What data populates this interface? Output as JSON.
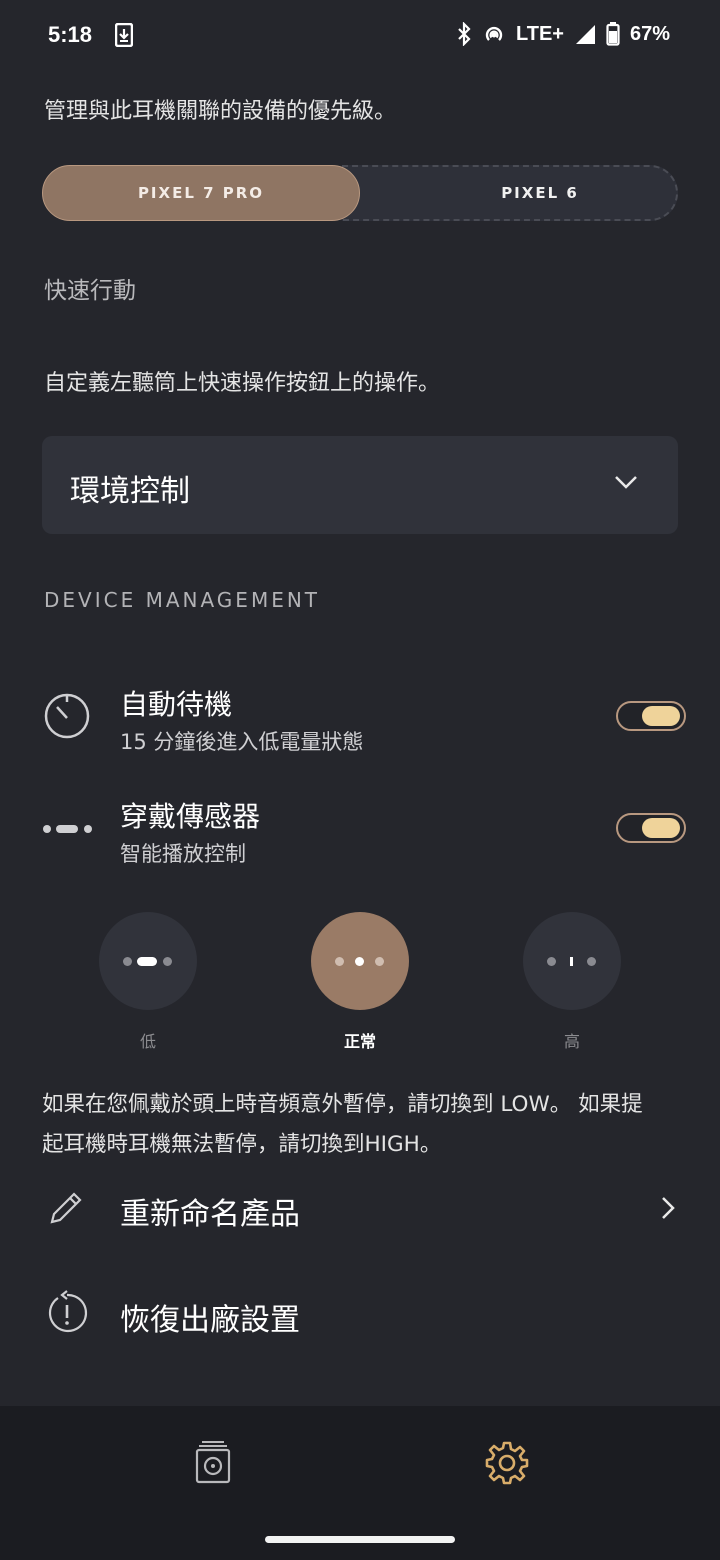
{
  "status_bar": {
    "time": "5:18",
    "network": "LTE+",
    "battery": "67%"
  },
  "priority": {
    "description": "管理與此耳機關聯的設備的優先級。",
    "devices": [
      "PIXEL 7 PRO",
      "PIXEL 6"
    ],
    "selected": "PIXEL 7 PRO"
  },
  "quick_action": {
    "title": "快速行動",
    "description": "自定義左聽筒上快速操作按鈕上的操作。",
    "value": "環境控制"
  },
  "device_management": {
    "heading": "DEVICE MANAGEMENT",
    "auto_standby": {
      "title": "自動待機",
      "subtitle": "15 分鐘後進入低電量狀態",
      "enabled": true
    },
    "wear_sensor": {
      "title": "穿戴傳感器",
      "subtitle": "智能播放控制",
      "enabled": true
    },
    "sensitivity": {
      "options": [
        "低",
        "正常",
        "高"
      ],
      "selected": "正常"
    },
    "sensitivity_note_line1": "如果在您佩戴於頭上時音頻意外暫停，請切換到 LOW。 如果提",
    "sensitivity_note_line2": "起耳機時耳機無法暫停，請切換到HIGH。",
    "rename": "重新命名產品",
    "reset": "恢復出廠設置"
  },
  "bottom_nav": {
    "items": [
      "device-icon",
      "gear-icon"
    ],
    "active": "gear-icon"
  },
  "colors": {
    "background": "#25262c",
    "accent": "#8f7563",
    "toggle_knob": "#efd39a",
    "active_icon": "#d9ad6a"
  }
}
